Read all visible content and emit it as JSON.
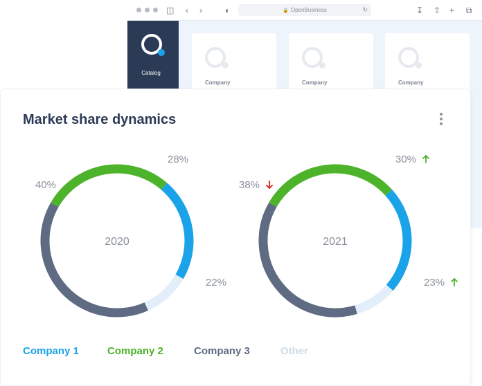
{
  "browser": {
    "address": "OpenBusiness",
    "sidebar_label": "Catalog",
    "cards": [
      "Company",
      "Company",
      "Company"
    ]
  },
  "title": "Market share dynamics",
  "colors": {
    "company1": "#1aa3e8",
    "company2": "#4cb32b",
    "company3": "#5f6b82",
    "other": "#e3eefb",
    "up": "#4cb32b",
    "down": "#d81b1b"
  },
  "legend": [
    "Company 1",
    "Company 2",
    "Company 3",
    "Other"
  ],
  "chart_data": [
    {
      "type": "pie",
      "center_label": "2020",
      "slices": [
        {
          "name": "Company 2",
          "value": 28,
          "label": "28%"
        },
        {
          "name": "Company 1",
          "value": 22,
          "label": "22%"
        },
        {
          "name": "Other",
          "value": 10,
          "label": ""
        },
        {
          "name": "Company 3",
          "value": 40,
          "label": "40%"
        }
      ]
    },
    {
      "type": "pie",
      "center_label": "2021",
      "slices": [
        {
          "name": "Company 2",
          "value": 30,
          "label": "30%",
          "trend": "up"
        },
        {
          "name": "Company 1",
          "value": 23,
          "label": "23%",
          "trend": "up"
        },
        {
          "name": "Other",
          "value": 9,
          "label": ""
        },
        {
          "name": "Company 3",
          "value": 38,
          "label": "38%",
          "trend": "down"
        }
      ]
    }
  ]
}
